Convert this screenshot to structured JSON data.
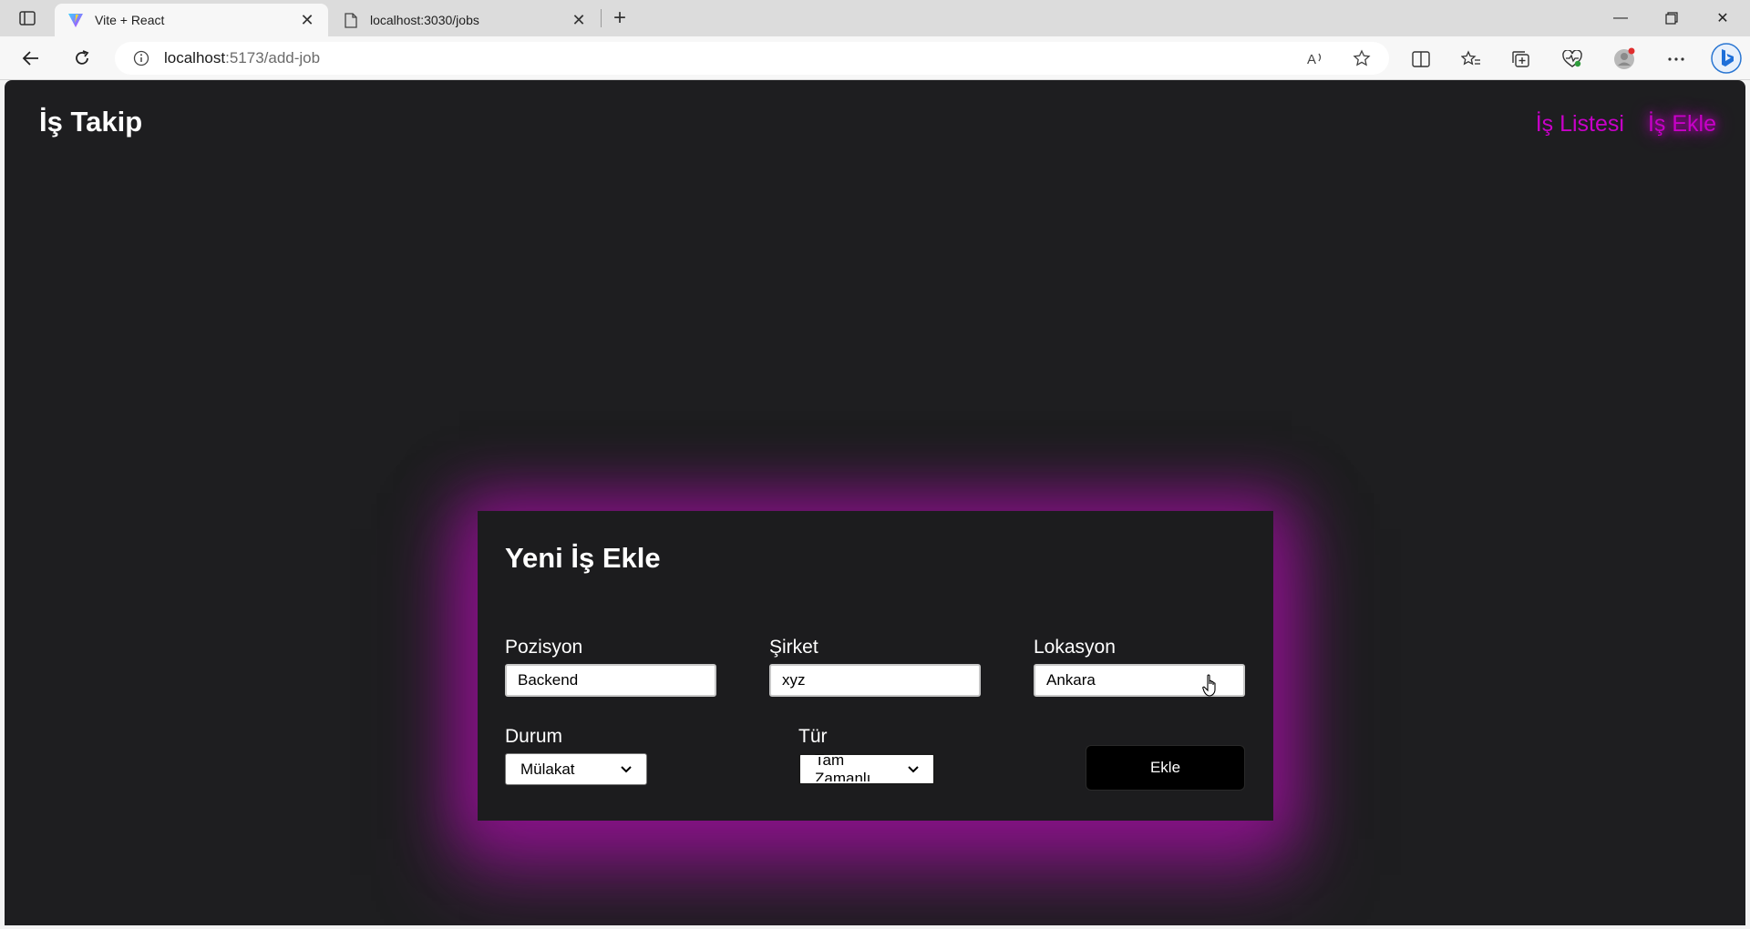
{
  "browser": {
    "tabs": [
      {
        "title": "Vite + React",
        "active": true,
        "icon": "vite-icon"
      },
      {
        "title": "localhost:3030/jobs",
        "active": false,
        "icon": "page-icon"
      }
    ],
    "url_host": "localhost",
    "url_rest": ":5173/add-job"
  },
  "app": {
    "brand": "İş Takip",
    "nav": [
      {
        "label": "İş Listesi",
        "active": false
      },
      {
        "label": "İş Ekle",
        "active": true
      }
    ],
    "accent_color": "#c800c8"
  },
  "form": {
    "title": "Yeni İş Ekle",
    "position": {
      "label": "Pozisyon",
      "value": "Backend"
    },
    "company": {
      "label": "Şirket",
      "value": "xyz"
    },
    "location": {
      "label": "Lokasyon",
      "value": "Ankara"
    },
    "status": {
      "label": "Durum",
      "value": "Mülakat"
    },
    "type": {
      "label": "Tür",
      "value": "Tam Zamanlı"
    },
    "submit_label": "Ekle"
  }
}
